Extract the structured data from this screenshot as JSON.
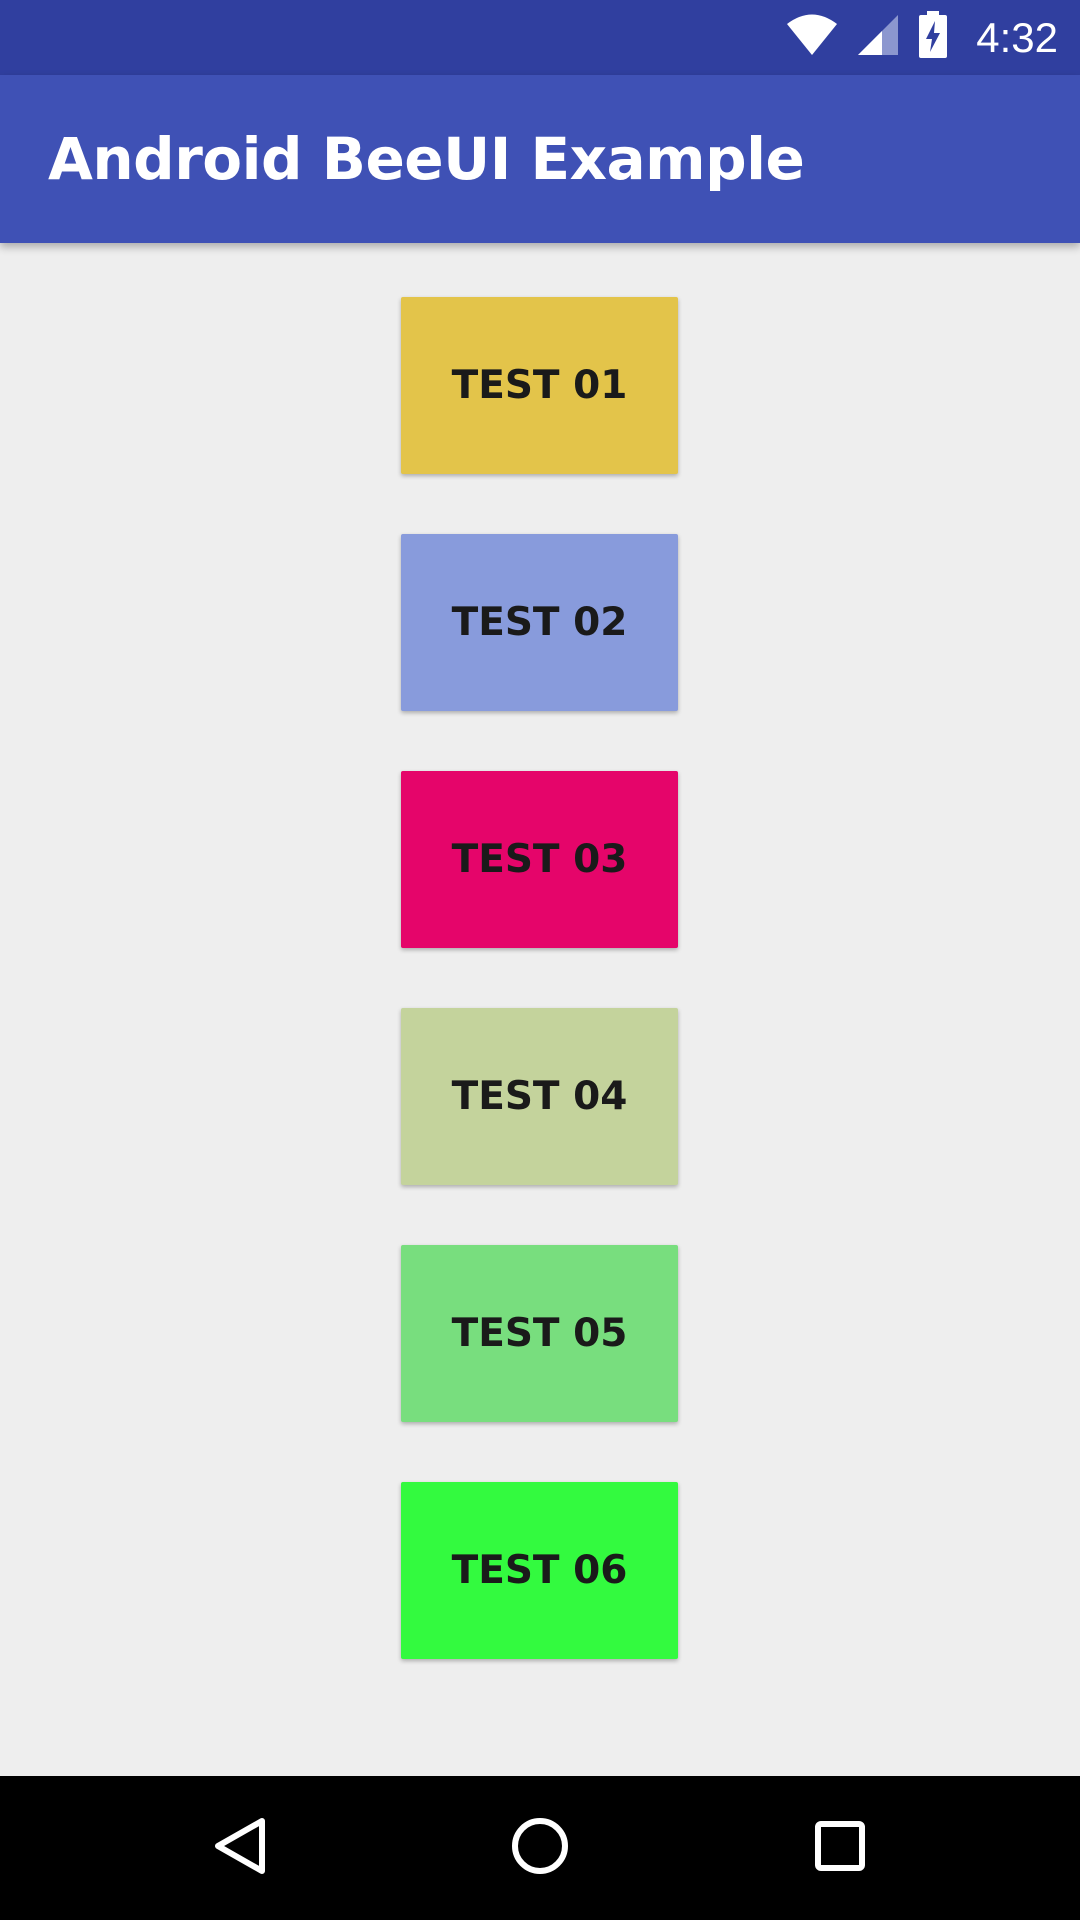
{
  "status_bar": {
    "time": "4:32",
    "icons": [
      "wifi-icon",
      "cell-signal-icon",
      "battery-charging-icon"
    ],
    "background": "#303f9f"
  },
  "app_bar": {
    "title": "Android BeeUI Example",
    "background": "#3f51b5"
  },
  "buttons": [
    {
      "label": "TEST 01",
      "color": "#e3c44a"
    },
    {
      "label": "TEST 02",
      "color": "#889bdc"
    },
    {
      "label": "TEST 03",
      "color": "#e5056a"
    },
    {
      "label": "TEST 04",
      "color": "#c4d39c"
    },
    {
      "label": "TEST 05",
      "color": "#78de7e"
    },
    {
      "label": "TEST 06",
      "color": "#33fa3f"
    }
  ],
  "nav_bar": {
    "icons": [
      "back-icon",
      "home-icon",
      "recents-icon"
    ],
    "background": "#000000"
  }
}
